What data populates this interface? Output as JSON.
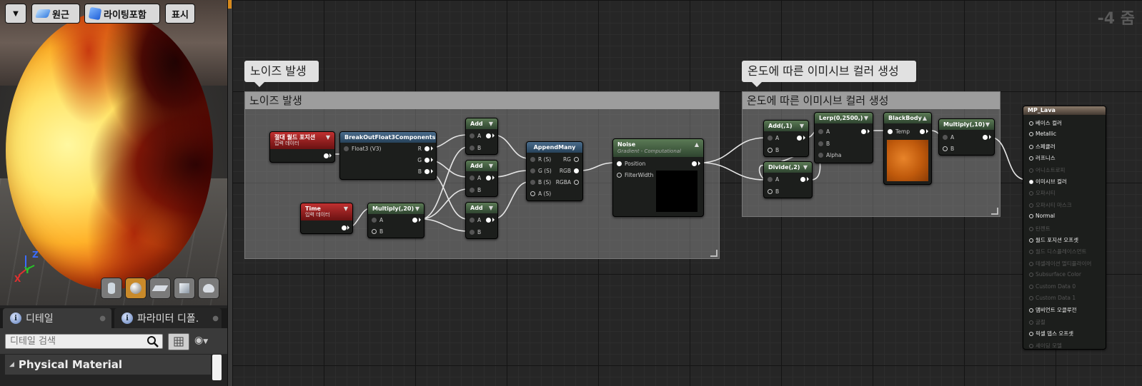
{
  "viewport": {
    "perspective_label": "원근",
    "lit_label": "라이팅포함",
    "show_label": "표시",
    "axes": {
      "z": "Z",
      "y": "Y",
      "x": "X"
    }
  },
  "panels": {
    "tabs": [
      {
        "label": "디테일"
      },
      {
        "label": "파라미터 디폴."
      }
    ],
    "search_placeholder": "디테일 검색",
    "category": "Physical Material"
  },
  "graph": {
    "zoom": "-4 줌",
    "comments": [
      {
        "label": "노이즈 발생"
      },
      {
        "label": "온도에 따른 이미시브 컬러 생성"
      }
    ],
    "nodes": {
      "absolute_world_position": {
        "title": "절대 월드 포지션",
        "subtitle": "입력 데이터"
      },
      "time": {
        "title": "Time",
        "subtitle": "입력 데이터"
      },
      "break_out": {
        "title": "BreakOutFloat3Components",
        "input": "Float3 (V3)",
        "outputs": [
          "R",
          "G",
          "B"
        ]
      },
      "multiply_20": {
        "title": "Multiply(,20)",
        "inputs": [
          "A",
          "B"
        ]
      },
      "add1": {
        "title": "Add",
        "inputs": [
          "A",
          "B"
        ]
      },
      "add2": {
        "title": "Add",
        "inputs": [
          "A",
          "B"
        ]
      },
      "add3": {
        "title": "Add",
        "inputs": [
          "A",
          "B"
        ]
      },
      "append_many": {
        "title": "AppendMany",
        "inputs": [
          "R (S)",
          "G (S)",
          "B (S)",
          "A (S)"
        ],
        "outputs": [
          "RG",
          "RGB",
          "RGBA"
        ]
      },
      "noise": {
        "title": "Noise",
        "subtitle": "Gradient - Computational",
        "inputs": [
          "Position",
          "FilterWidth"
        ]
      },
      "add_1": {
        "title": "Add(,1)",
        "inputs": [
          "A",
          "B"
        ]
      },
      "divide_2": {
        "title": "Divide(,2)",
        "inputs": [
          "A",
          "B"
        ]
      },
      "lerp": {
        "title": "Lerp(0,2500,)",
        "inputs": [
          "A",
          "B",
          "Alpha"
        ]
      },
      "blackbody": {
        "title": "BlackBody",
        "inputs": [
          "Temp"
        ]
      },
      "multiply_10": {
        "title": "Multiply(,10)",
        "inputs": [
          "A",
          "B"
        ]
      }
    },
    "result": {
      "title": "MP_Lava",
      "pins": [
        {
          "label": "베이스 컬러",
          "active": true
        },
        {
          "label": "Metallic",
          "active": true
        },
        {
          "label": "스페큘러",
          "active": true
        },
        {
          "label": "러프니스",
          "active": true
        },
        {
          "label": "어니소트로피",
          "active": false
        },
        {
          "label": "이미시브 컬러",
          "active": true
        },
        {
          "label": "오파시티",
          "active": false
        },
        {
          "label": "오파시티 마스크",
          "active": false
        },
        {
          "label": "Normal",
          "active": true
        },
        {
          "label": "탄젠트",
          "active": false
        },
        {
          "label": "월드 포지션 오프셋",
          "active": true
        },
        {
          "label": "월드 디스플레이스먼트",
          "active": false
        },
        {
          "label": "테셀레이션 멀티플라이어",
          "active": false
        },
        {
          "label": "Subsurface Color",
          "active": false
        },
        {
          "label": "Custom Data 0",
          "active": false
        },
        {
          "label": "Custom Data 1",
          "active": false
        },
        {
          "label": "앰비언트 오클루전",
          "active": true
        },
        {
          "label": "굴절",
          "active": false
        },
        {
          "label": "픽셀 뎁스 오프셋",
          "active": true
        },
        {
          "label": "셰이딩 모델",
          "active": false
        }
      ]
    }
  }
}
